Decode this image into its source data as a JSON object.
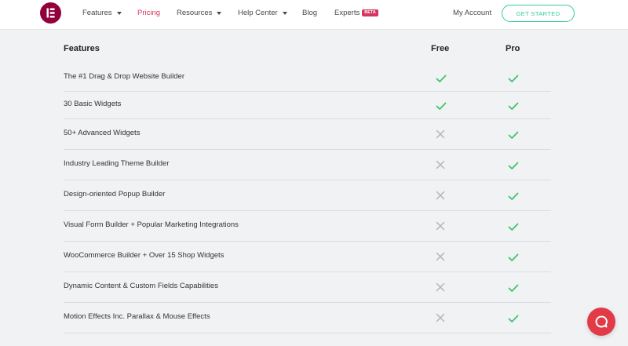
{
  "header": {
    "logo_icon": "elementor-logo-icon",
    "nav": [
      {
        "label": "Features",
        "has_caret": true
      },
      {
        "label": "Pricing",
        "active": true
      },
      {
        "label": "Resources",
        "has_caret": true
      },
      {
        "label": "Help Center",
        "has_caret": true
      },
      {
        "label": "Blog"
      },
      {
        "label": "Experts",
        "badge": "BETA"
      }
    ],
    "account_label": "My Account",
    "cta_label": "GET STARTED"
  },
  "table": {
    "headers": {
      "feature": "Features",
      "free": "Free",
      "pro": "Pro"
    },
    "rows": [
      {
        "label": "The #1 Drag & Drop Website Builder",
        "free": true,
        "pro": true
      },
      {
        "label": "30 Basic Widgets",
        "free": true,
        "pro": true
      },
      {
        "label": "50+ Advanced Widgets",
        "free": false,
        "pro": true
      },
      {
        "label": "Industry Leading Theme Builder",
        "free": false,
        "pro": true
      },
      {
        "label": "Design-oriented Popup Builder",
        "free": false,
        "pro": true
      },
      {
        "label": "Visual Form Builder + Popular Marketing Integrations",
        "free": false,
        "pro": true
      },
      {
        "label": "WooCommerce Builder + Over 15 Shop Widgets",
        "free": false,
        "pro": true
      },
      {
        "label": "Dynamic Content & Custom Fields Capabilities",
        "free": false,
        "pro": true
      },
      {
        "label": "Motion Effects Inc. Parallax & Mouse Effects",
        "free": false,
        "pro": true
      }
    ]
  },
  "chat_icon": "chat-bubble-icon",
  "colors": {
    "accent_pink": "#d5355f",
    "logo": "#92003b",
    "cta_green": "#34cc9b",
    "check_green": "#3ec46d",
    "cross_gray": "#b5b5b5",
    "chat_red": "#e13b48"
  }
}
